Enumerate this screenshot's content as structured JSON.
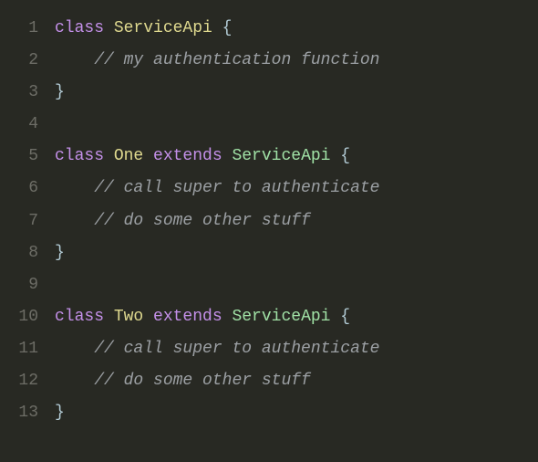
{
  "code": {
    "lines": [
      {
        "num": "1",
        "tokens": [
          {
            "class": "tok-keyword",
            "text": "class "
          },
          {
            "class": "tok-classname",
            "text": "ServiceApi "
          },
          {
            "class": "tok-brace",
            "text": "{"
          }
        ]
      },
      {
        "num": "2",
        "tokens": [
          {
            "class": "tok-space",
            "text": "    "
          },
          {
            "class": "tok-comment",
            "text": "// my authentication function"
          }
        ]
      },
      {
        "num": "3",
        "tokens": [
          {
            "class": "tok-brace",
            "text": "}"
          }
        ]
      },
      {
        "num": "4",
        "tokens": []
      },
      {
        "num": "5",
        "tokens": [
          {
            "class": "tok-keyword",
            "text": "class "
          },
          {
            "class": "tok-classname",
            "text": "One "
          },
          {
            "class": "tok-keyword",
            "text": "extends "
          },
          {
            "class": "tok-typename",
            "text": "ServiceApi "
          },
          {
            "class": "tok-brace",
            "text": "{"
          }
        ]
      },
      {
        "num": "6",
        "tokens": [
          {
            "class": "tok-space",
            "text": "    "
          },
          {
            "class": "tok-comment",
            "text": "// call super to authenticate"
          }
        ]
      },
      {
        "num": "7",
        "tokens": [
          {
            "class": "tok-space",
            "text": "    "
          },
          {
            "class": "tok-comment",
            "text": "// do some other stuff"
          }
        ]
      },
      {
        "num": "8",
        "tokens": [
          {
            "class": "tok-brace",
            "text": "}"
          }
        ]
      },
      {
        "num": "9",
        "tokens": []
      },
      {
        "num": "10",
        "tokens": [
          {
            "class": "tok-keyword",
            "text": "class "
          },
          {
            "class": "tok-classname",
            "text": "Two "
          },
          {
            "class": "tok-keyword",
            "text": "extends "
          },
          {
            "class": "tok-typename",
            "text": "ServiceApi "
          },
          {
            "class": "tok-brace",
            "text": "{"
          }
        ]
      },
      {
        "num": "11",
        "tokens": [
          {
            "class": "tok-space",
            "text": "    "
          },
          {
            "class": "tok-comment",
            "text": "// call super to authenticate"
          }
        ]
      },
      {
        "num": "12",
        "tokens": [
          {
            "class": "tok-space",
            "text": "    "
          },
          {
            "class": "tok-comment",
            "text": "// do some other stuff"
          }
        ]
      },
      {
        "num": "13",
        "tokens": [
          {
            "class": "tok-brace",
            "text": "}"
          }
        ]
      }
    ]
  }
}
